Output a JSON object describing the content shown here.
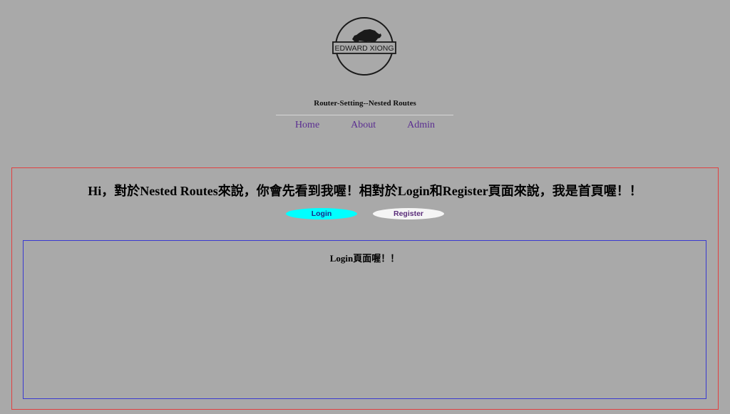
{
  "header": {
    "logo_text": "EDWARD XIONG",
    "site_title": "Router-Setting--Nested Routes"
  },
  "nav": {
    "items": [
      {
        "label": "Home"
      },
      {
        "label": "About"
      },
      {
        "label": "Admin"
      }
    ],
    "link_color": "#5a2d91"
  },
  "main": {
    "headline": "Hi，對於Nested Routes來說，你會先看到我喔！相對於Login和Register頁面來說，我是首頁喔！！",
    "buttons": {
      "login_label": "Login",
      "register_label": "Register"
    },
    "outlet": {
      "title": "Login頁面喔！！"
    }
  },
  "colors": {
    "background": "#a9a9a9",
    "outer_border": "#e04040",
    "inner_border": "#3a3ad0",
    "login_button": "#00ffff",
    "register_button": "#f5f5f5"
  }
}
